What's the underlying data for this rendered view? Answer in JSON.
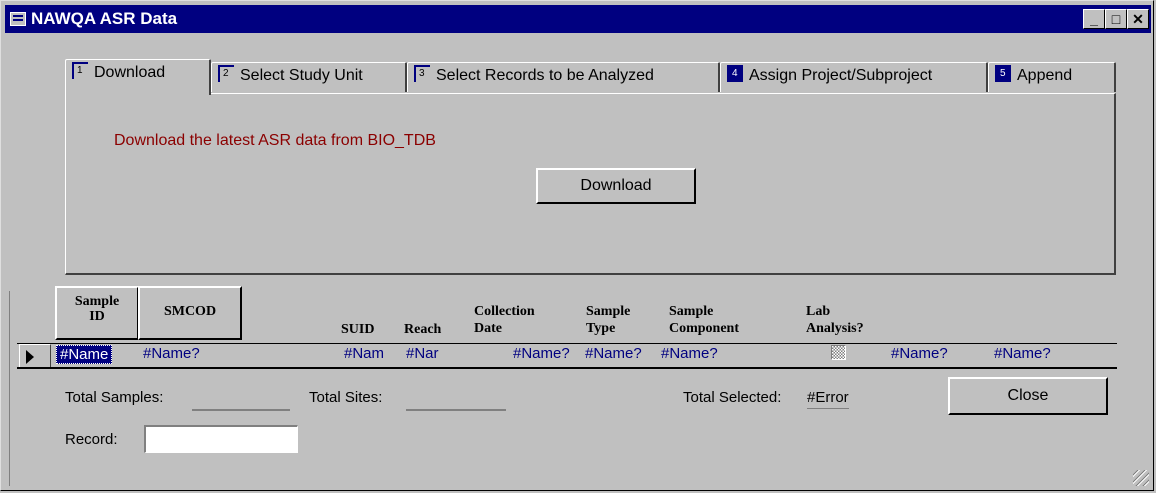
{
  "window": {
    "title": "NAWQA ASR Data"
  },
  "tabs": [
    {
      "num": "1",
      "label": "Download"
    },
    {
      "num": "2",
      "label": "Select Study Unit"
    },
    {
      "num": "3",
      "label": "Select Records to be Analyzed"
    },
    {
      "num": "4",
      "label": "Assign Project/Subproject"
    },
    {
      "num": "5",
      "label": "Append"
    }
  ],
  "download_panel": {
    "message": "Download the latest ASR data from BIO_TDB",
    "button_label": "Download"
  },
  "columns": {
    "sample_id": [
      "Sample",
      "ID"
    ],
    "smcod": "SMCOD",
    "suid": "SUID",
    "reach": "Reach",
    "collection_date": [
      "Collection",
      "Date"
    ],
    "sample_type": [
      "Sample",
      "Type"
    ],
    "sample_component": [
      "Sample",
      "Component"
    ],
    "lab_analysis": [
      "Lab",
      "Analysis?"
    ]
  },
  "row": {
    "sample_id": "#Name",
    "smcod": "#Name?",
    "suid": "#Nam",
    "reach": "#Nar",
    "collection_date": "#Name?",
    "sample_type": "#Name?",
    "sample_component": "#Name?",
    "extra1": "#Name?",
    "extra2": "#Name?"
  },
  "footer": {
    "total_samples_label": "Total Samples:",
    "total_sites_label": "Total Sites:",
    "total_selected_label": "Total Selected:",
    "total_selected_value": "#Error",
    "close_label": "Close",
    "record_label": "Record:"
  },
  "colors": {
    "titlebar": "#000080",
    "message": "#8b0000",
    "field_text": "#000080"
  }
}
